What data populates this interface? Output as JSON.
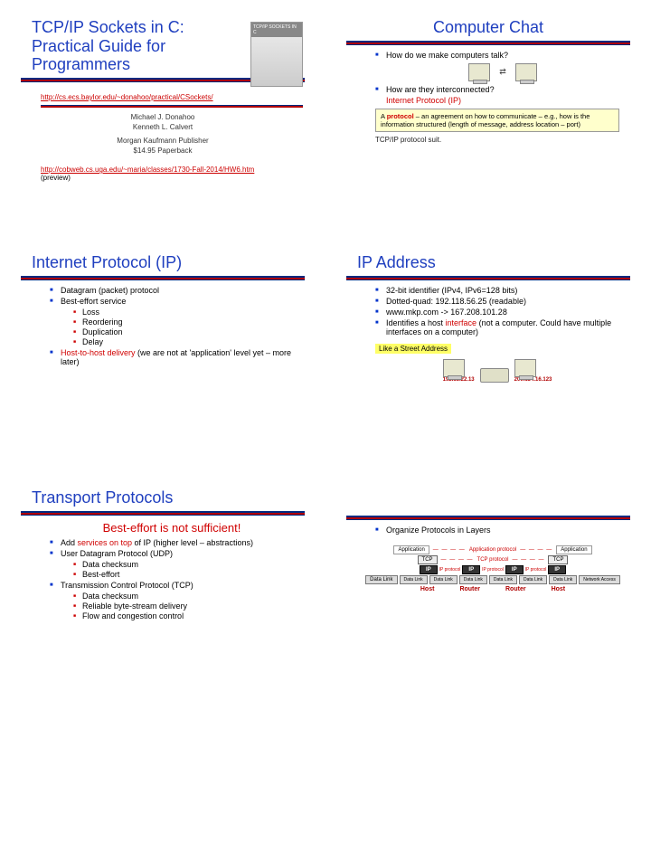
{
  "slide1": {
    "title": "TCP/IP Sockets in C: Practical Guide for Programmers",
    "link1": "http://cs.ecs.baylor.edu/~donahoo/practical/CSockets/",
    "author1": "Michael J. Donahoo",
    "author2": "Kenneth L. Calvert",
    "publisher": "Morgan Kaufmann Publisher",
    "price": "$14.95 Paperback",
    "link2": "http://cobweb.cs.uga.edu/~maria/classes/1730-Fall-2014/HW6.htm",
    "preview": "(preview)"
  },
  "slide2": {
    "title": "Computer Chat",
    "q1": "How do we make computers talk?",
    "q2": "How are they interconnected?",
    "ipline": "Internet Protocol (IP)",
    "protobox_a": "A ",
    "protobox_b": "protocol",
    "protobox_c": " – an agreement on how to communicate – e.g., how is the information structured (length of message, address location – port)",
    "suit": "TCP/IP protocol suit."
  },
  "slide3": {
    "title": "Internet Protocol (IP)",
    "i1": "Datagram (packet) protocol",
    "i2": "Best-effort service",
    "s1": "Loss",
    "s2": "Reordering",
    "s3": "Duplication",
    "s4": "Delay",
    "i3a": "Host-to-host delivery",
    "i3b": " (we are not at 'application' level yet – more later)"
  },
  "slide4": {
    "title": "IP Address",
    "i1": "32-bit identifier (IPv4, IPv6=128 bits)",
    "i2": "Dotted-quad: 192.118.56.25 (readable)",
    "i3": "www.mkp.com  ->  167.208.101.28",
    "i4a": "Identifies a host ",
    "i4b": "interface",
    "i4c": " (not a computer. Could  have multiple interfaces on a computer)",
    "street": "Like a Street Address",
    "ip1": "192.18.22.13",
    "ip2": "209.134.16.123"
  },
  "slide5": {
    "title": "Transport Protocols",
    "subtitle": "Best-effort  is not sufficient!",
    "i1a": "Add ",
    "i1b": "services on top",
    "i1c": " of IP (higher level – abstractions)",
    "i2": "User Datagram Protocol (UDP)",
    "s2a": "Data checksum",
    "s2b": "Best-effort",
    "i3": "Transmission Control Protocol (TCP)",
    "s3a": "Data checksum",
    "s3b": "Reliable byte-stream delivery",
    "s3c": "Flow and congestion control"
  },
  "slide6": {
    "i1": "Organize Protocols in Layers",
    "labels": {
      "app": "Application",
      "tcp": "TCP",
      "ip": "IP",
      "dl": "Data Link",
      "na": "Network Access",
      "appproto": "Application protocol",
      "tcpproto": "TCP protocol",
      "ipproto": "IP protocol",
      "host": "Host",
      "router": "Router"
    }
  }
}
